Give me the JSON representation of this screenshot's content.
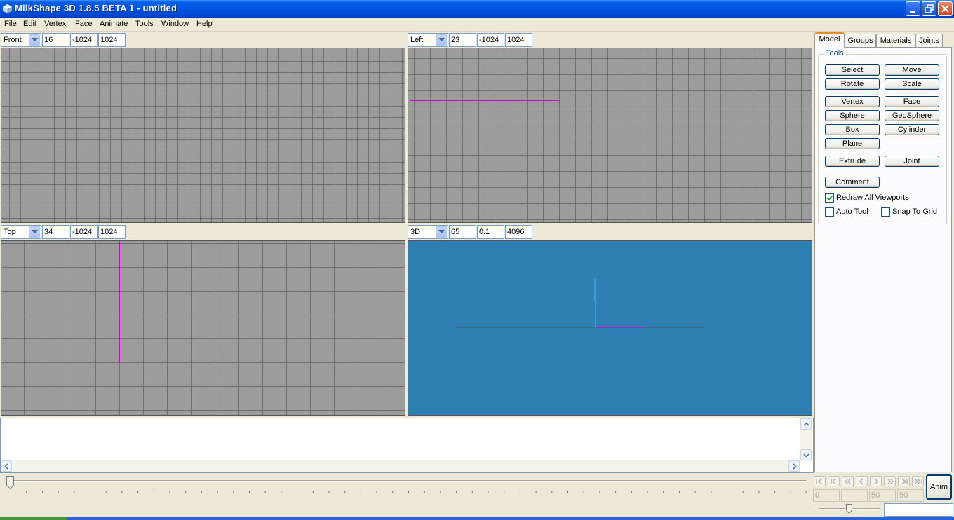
{
  "window": {
    "title": "MilkShape 3D 1.8.5 BETA 1 - untitled"
  },
  "menu": [
    "File",
    "Edit",
    "Vertex",
    "Face",
    "Animate",
    "Tools",
    "Window",
    "Help"
  ],
  "viewports": [
    {
      "view": "Front",
      "value1": "16",
      "value2": "-1024",
      "value3": "1024"
    },
    {
      "view": "Left",
      "value1": "23",
      "value2": "-1024",
      "value3": "1024"
    },
    {
      "view": "Top",
      "value1": "34",
      "value2": "-1024",
      "value3": "1024"
    },
    {
      "view": "3D",
      "value1": "65",
      "value2": "0.1",
      "value3": "4096"
    }
  ],
  "tabs": [
    "Model",
    "Groups",
    "Materials",
    "Joints"
  ],
  "tools": {
    "legend": "Tools",
    "select": "Select",
    "move": "Move",
    "rotate": "Rotate",
    "scale": "Scale",
    "vertex": "Vertex",
    "face": "Face",
    "sphere": "Sphere",
    "geosphere": "GeoSphere",
    "box": "Box",
    "cylinder": "Cylinder",
    "plane": "Plane",
    "extrude": "Extrude",
    "joint": "Joint",
    "comment": "Comment"
  },
  "options": {
    "redraw_all": {
      "label": "Redraw All Viewports",
      "checked": true
    },
    "auto_tool": {
      "label": "Auto Tool",
      "checked": false
    },
    "snap_to_grid": {
      "label": "Snap To Grid",
      "checked": false
    }
  },
  "animation": {
    "anim_label": "Anim",
    "frame_current": "0",
    "frame_start": "",
    "frame_end": "50",
    "frame_total": "50"
  },
  "colors": {
    "grid_bg": "#9c9c9c",
    "grid_line": "#6e6e6e",
    "perspective_bg": "#2f7fb3",
    "axis_magenta": "#d500d5",
    "axis_cyan": "#00d8ff"
  }
}
